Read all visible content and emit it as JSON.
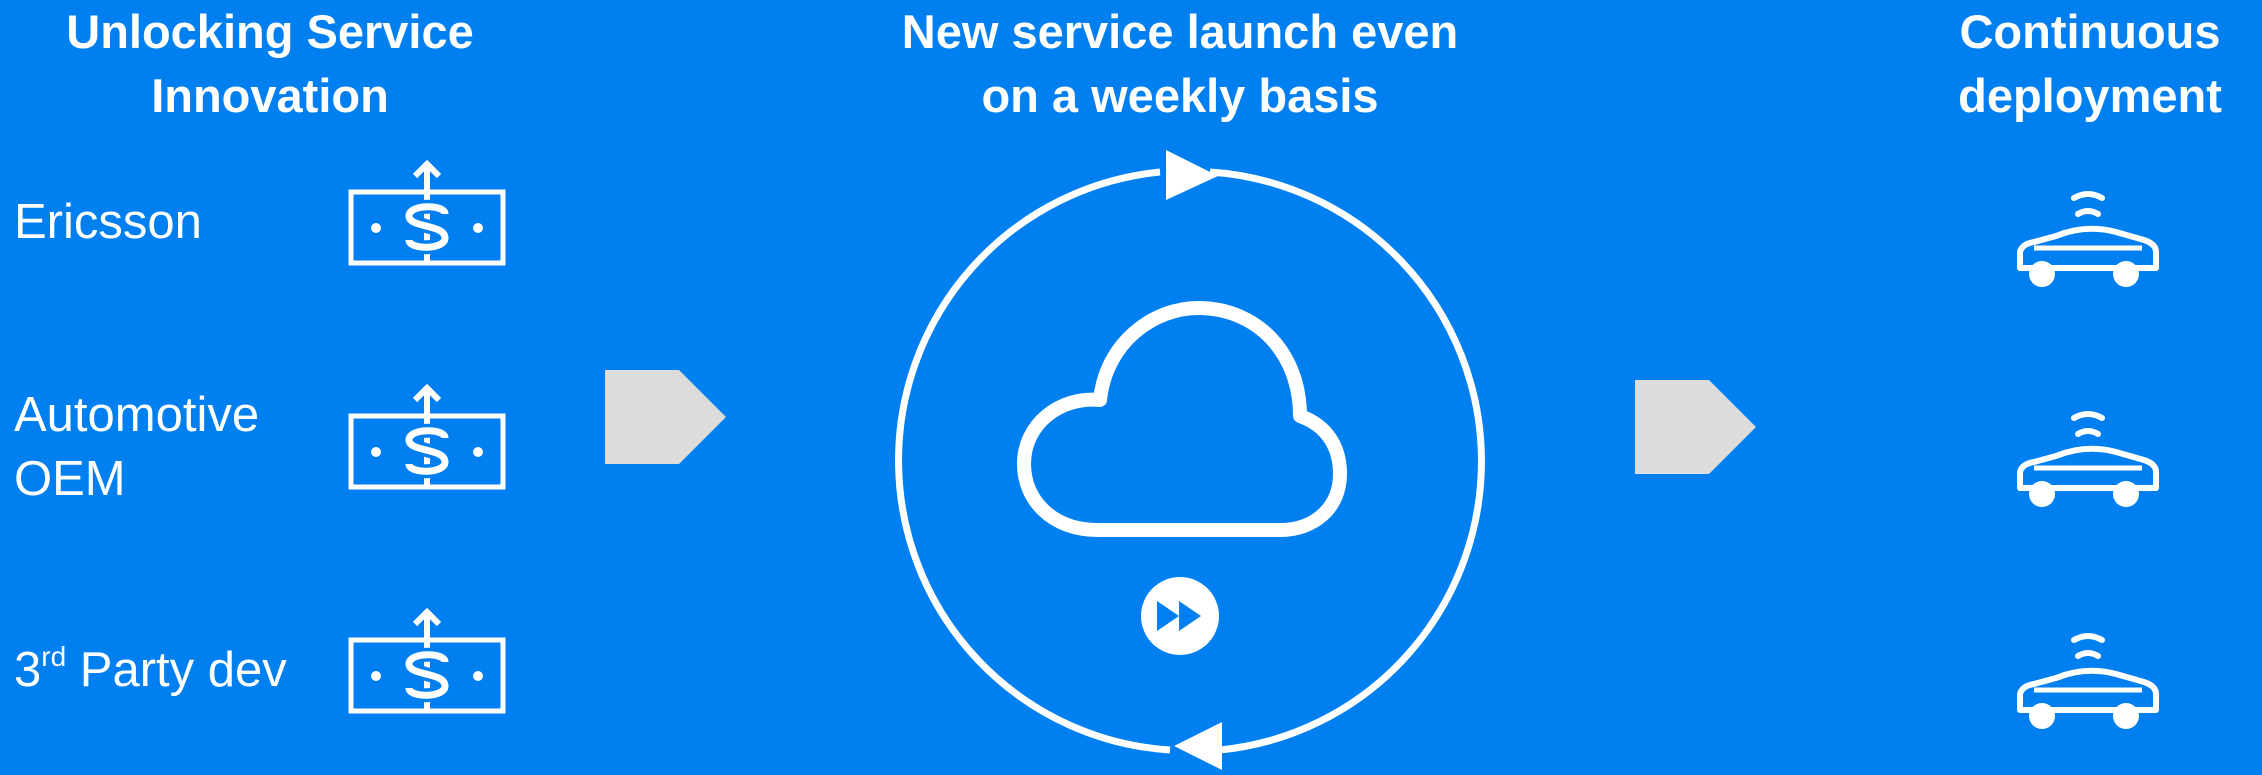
{
  "left_column": {
    "heading_line1": "Unlocking Service",
    "heading_line2": "Innovation",
    "items": [
      {
        "label": "Ericsson",
        "icon": "money-growth-icon"
      },
      {
        "label_line1": "Automotive",
        "label_line2": "OEM",
        "icon": "money-growth-icon"
      },
      {
        "label_prefix": "3",
        "label_sup": "rd",
        "label_rest": " Party dev",
        "icon": "money-growth-icon"
      }
    ]
  },
  "center": {
    "heading_line1": "New service launch even",
    "heading_line2": "on a weekly basis",
    "icons": [
      "cycle-arrows-icon",
      "cloud-icon",
      "fast-forward-icon"
    ]
  },
  "right_column": {
    "heading_line1": "Continuous",
    "heading_line2": "deployment",
    "items": [
      {
        "icon": "connected-car-icon"
      },
      {
        "icon": "connected-car-icon"
      },
      {
        "icon": "connected-car-icon"
      }
    ]
  },
  "colors": {
    "background": "#0080F0",
    "foreground": "#FFFFFF",
    "arrow_fill": "#DCDCDC"
  }
}
